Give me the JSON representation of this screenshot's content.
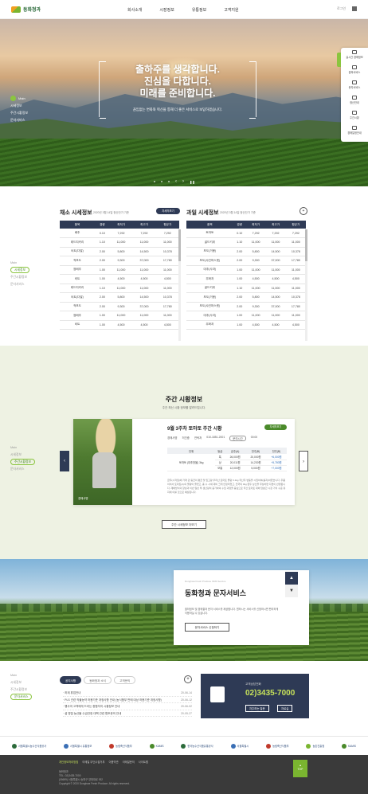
{
  "header": {
    "logo_text": "동화청과",
    "nav": [
      "회사소개",
      "시장정보",
      "유통정보",
      "고객지원"
    ],
    "login": "로그인"
  },
  "hero": {
    "title_lines": [
      "출하주를 생각합니다.",
      "진심을 다합니다.",
      "미래를 준비합니다."
    ],
    "subtitle": "끊임없는 변화와 혁신을 통해 더 좋은 서비스로 보답하겠습니다.",
    "nav": [
      "Main",
      "시세정보",
      "주간시황정보",
      "문자서비스"
    ],
    "controls": {
      "prev": "‹",
      "next": "›",
      "pause": "❚❚"
    }
  },
  "quick_menu": [
    "실시간 경매정보",
    "출하서비스",
    "문자서비스",
    "정산안내",
    "주간시황",
    "경매일정안내"
  ],
  "price": {
    "sidenav": [
      "Main",
      "시세정보",
      "주간시황정보",
      "문자서비스"
    ],
    "veg": {
      "title": "채소 시세정보",
      "date": "2020년 3월 14일 정산단가 기준",
      "button": "자세히보기",
      "headers": [
        "품목",
        "경량",
        "최저가",
        "최고가",
        "평균가"
      ],
      "rows": [
        [
          "배추",
          "0.10",
          "7,292",
          "7,292",
          "7,292"
        ],
        [
          "레드치커리",
          "1.10",
          "11,000",
          "11,000",
          "11,000"
        ],
        [
          "비트(다발)",
          "2.00",
          "5,800",
          "14,500",
          "10,378"
        ],
        [
          "적포도",
          "2.00",
          "9,300",
          "37,000",
          "17,780"
        ],
        [
          "쌈배추",
          "1.00",
          "11,000",
          "11,000",
          "11,000"
        ],
        [
          "비트",
          "1.00",
          "4,500",
          "4,500",
          "4,500"
        ],
        [
          "레드치커리",
          "1.10",
          "11,000",
          "11,000",
          "11,000"
        ],
        [
          "비트(다발)",
          "2.00",
          "5,800",
          "14,500",
          "10,378"
        ],
        [
          "적포도",
          "2.00",
          "9,300",
          "37,000",
          "17,780"
        ],
        [
          "쌈배추",
          "1.00",
          "11,000",
          "11,000",
          "11,000"
        ],
        [
          "비트",
          "1.00",
          "4,500",
          "4,500",
          "4,500"
        ]
      ]
    },
    "fruit": {
      "title": "과일 시세정보",
      "date": "2020년 3월 14일 정산단가 기준",
      "more": "+",
      "headers": [
        "품목",
        "경량",
        "최저가",
        "최고가",
        "평균가"
      ],
      "rows": [
        [
          "토마토",
          "0.10",
          "7,292",
          "7,292",
          "7,292"
        ],
        [
          "골드키위",
          "1.10",
          "11,000",
          "11,000",
          "11,000"
        ],
        [
          "포도(거봉)",
          "2.00",
          "5,800",
          "14,500",
          "10,378"
        ],
        [
          "포도(샤인머스켓)",
          "2.00",
          "9,300",
          "37,000",
          "17,780"
        ],
        [
          "대추(사과)",
          "1.00",
          "11,000",
          "11,000",
          "11,000"
        ],
        [
          "무화과",
          "1.00",
          "4,500",
          "4,500",
          "4,500"
        ],
        [
          "골드키위",
          "1.10",
          "11,000",
          "11,000",
          "11,000"
        ],
        [
          "포도(거봉)",
          "2.00",
          "5,800",
          "14,500",
          "10,378"
        ],
        [
          "포도(샤인머스켓)",
          "2.00",
          "9,300",
          "37,000",
          "17,780"
        ],
        [
          "대추(사과)",
          "1.00",
          "11,000",
          "11,000",
          "11,000"
        ],
        [
          "무화과",
          "1.00",
          "4,500",
          "4,500",
          "4,500"
        ]
      ]
    }
  },
  "weekly": {
    "sidenav": [
      "Main",
      "시세정보",
      "주간시황정보",
      "문자서비스"
    ],
    "title": "주간 시황정보",
    "subtitle": "주간 최신 시황 정보를 알려드립니다.",
    "card": {
      "heading": "9월 3주차 토마토 주간 시황",
      "badge": "자세히보기",
      "meta_1": "경매사명",
      "meta_1_val": "허진중",
      "meta_2": "연락처",
      "meta_2_val": "010-1851-2001",
      "meta_3": "문의시간",
      "meta_3_val": "00:00",
      "photo_caption": "경매사명",
      "table_headers": [
        "단위",
        "등급",
        "금주(A)",
        "전주(B)",
        "전주(B)"
      ],
      "unit": "토마토 (대추방울) 3kg",
      "rows": [
        [
          "특",
          "26,000원",
          "20,000원",
          "+6,000원"
        ],
        [
          "상",
          "20,011원",
          "14,230원",
          "+5,780원"
        ],
        [
          "보통",
          "12,000원",
          "5,000원",
          "+7,000원"
        ]
      ],
      "desc": "금주(시작일)에 거래 관 등급의 평균 및 입고량 우리산 토마토 물량 3.1kg 국산주 변동을 시킬하여(봉지)하였습니다. 주품이어서 토마토(A)의 물량이 줄었고, 총 수 시세 대비 크게 안정되었고, 전국의 3kg 완두 상산을 무상하면 다면이 반영됩니다. 재배방식의 향상과 이번 일반 투 생산량이 증가하여 수입 과정을 중심으로 국산 토마토 대체 당분간 시장 가치 수준 유지에 이를 것으로 예상됩니다."
    },
    "more": "주간 시세정보 더보기",
    "prev": "‹",
    "next": "›"
  },
  "sms": {
    "en": "Donghwa Fresh Produce SMS Service",
    "title": "동화청과 문자서비스",
    "desc": "출하정보 및 경매결과 문자 서비스를 제공합니다. 원하시는 서비스를 신청하시면 편리하게 이용하실 수 있습니다.",
    "button": "문자서비스 신청하기",
    "up": "▲",
    "down": "▼"
  },
  "notice": {
    "sidenav": [
      "Main",
      "시세정보",
      "주간시황정보",
      "문자서비스"
    ],
    "tabs": [
      "공지사항",
      "동화청과 소식",
      "고객문의"
    ],
    "plus": "+",
    "items": [
      {
        "title": "하계 휴업안내",
        "date": "20-06-14"
      },
      {
        "title": "PLS 관련 작물농약 허용기준 개정사항 안내 (농식품부 판매 대상 허용기준 개정사항)",
        "date": "20-06-12"
      },
      {
        "title": "행사여 고객에게 드리는 종합지지 시황정보 안내",
        "date": "20-06-02"
      },
      {
        "title": "설 명절 농산물 수급안정 대책 관련 협조문의 안내",
        "date": "20-05-27"
      }
    ],
    "call": {
      "label": "고객상담전화",
      "number": "02)3435-7000",
      "btn1": "자주하는 질문",
      "btn2": "자료실"
    }
  },
  "banners": [
    {
      "name": "서울특별시농수산식품공사",
      "color": "#2b6a3a"
    },
    {
      "name": "서울특별시 유통정보",
      "color": "#3a6fb5"
    },
    {
      "name": "농림축산식품부",
      "color": "#c0392b"
    },
    {
      "name": "KAMIS",
      "color": "#4a8a2a"
    },
    {
      "name": "한국농수산식품유통공사",
      "color": "#2b6a3a"
    },
    {
      "name": "서울특별시",
      "color": "#3a6fb5"
    },
    {
      "name": "농림축산식품부",
      "color": "#c0392b"
    },
    {
      "name": "농촌진흥청",
      "color": "#7ab530"
    },
    {
      "name": "KAMIS",
      "color": "#4a8a2a"
    }
  ],
  "footer": {
    "links": [
      "개인정보처리방침",
      "이메일 무단수집거부",
      "이용약관",
      "이메일문의",
      "사이트맵"
    ],
    "info": [
      "동화청과",
      "TEL. 02)3435-7000",
      "(05699) 서울특별시 송파구 양재대로 932",
      "Copyright © 2020 Donghwa Fresh Produce. All rights reserved."
    ],
    "top": "TOP"
  },
  "colors": {
    "navy": "#2e3a55",
    "green": "#8bc53f",
    "accent": "#c6e15a"
  }
}
